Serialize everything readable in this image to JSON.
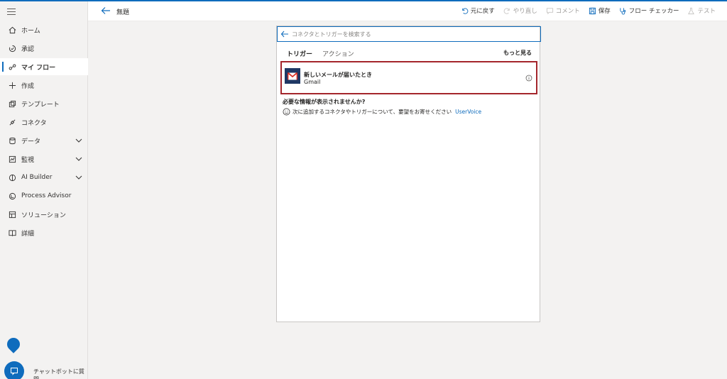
{
  "header": {
    "title": "無題",
    "toolbar": {
      "undo": "元に戻す",
      "redo": "やり直し",
      "comment": "コメント",
      "save": "保存",
      "flow_checker": "フロー チェッカー",
      "test": "テスト"
    }
  },
  "sidebar": {
    "items": [
      {
        "label": "ホーム",
        "icon": "home-icon"
      },
      {
        "label": "承認",
        "icon": "approvals-icon"
      },
      {
        "label": "マイ フロー",
        "icon": "flow-icon",
        "active": true
      },
      {
        "label": "作成",
        "icon": "plus-icon"
      },
      {
        "label": "テンプレート",
        "icon": "template-icon"
      },
      {
        "label": "コネクタ",
        "icon": "connector-icon"
      },
      {
        "label": "データ",
        "icon": "database-icon",
        "expandable": true
      },
      {
        "label": "監視",
        "icon": "monitor-icon",
        "expandable": true
      },
      {
        "label": "AI Builder",
        "icon": "ai-builder-icon",
        "expandable": true
      },
      {
        "label": "Process Advisor",
        "icon": "process-advisor-icon"
      },
      {
        "label": "ソリューション",
        "icon": "solution-icon"
      },
      {
        "label": "詳細",
        "icon": "book-icon"
      }
    ],
    "chatbot_label": "チャットボットに質問"
  },
  "panel": {
    "search_placeholder": "コネクタとトリガーを検索する",
    "tabs": [
      {
        "label": "トリガー",
        "active": true
      },
      {
        "label": "アクション",
        "active": false
      }
    ],
    "more_label": "もっと見る",
    "trigger": {
      "name": "新しいメールが届いたとき",
      "connector": "Gmail"
    },
    "help_title": "必要な情報が表示されませんか?",
    "help_text": "次に追加するコネクタやトリガーについて、要望をお寄せください",
    "help_link": "UserVoice"
  },
  "colors": {
    "accent": "#0f6cbd",
    "highlight_border": "#a4262c",
    "gmail_tile": "#1f3864"
  }
}
